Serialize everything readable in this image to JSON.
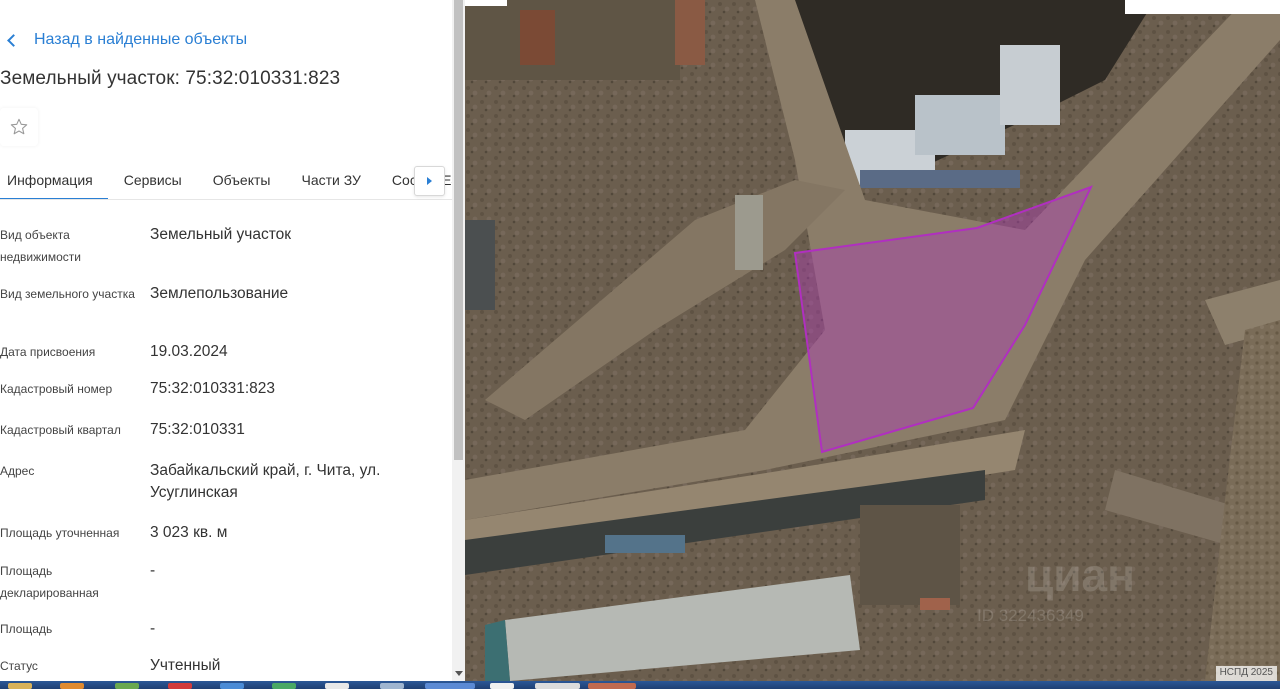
{
  "back_link": "Назад в найденные объекты",
  "page_title": "Земельный участок: 75:32:010331:823",
  "tabs": [
    {
      "label": "Информация",
      "active": true
    },
    {
      "label": "Сервисы",
      "active": false
    },
    {
      "label": "Объекты",
      "active": false
    },
    {
      "label": "Части ЗУ",
      "active": false
    },
    {
      "label": "Состав ЕЗ",
      "active": false
    }
  ],
  "fields": [
    {
      "label": "Вид объекта недвижимости",
      "value": "Земельный участок"
    },
    {
      "label": "Вид земельного участка",
      "value": "Землепользование"
    },
    {
      "label": "Дата присвоения",
      "value": "19.03.2024"
    },
    {
      "label": "Кадастровый номер",
      "value": "75:32:010331:823"
    },
    {
      "label": "Кадастровый квартал",
      "value": "75:32:010331"
    },
    {
      "label": "Адрес",
      "value": "Забайкальский край, г. Чита, ул. Усуглинская"
    },
    {
      "label": "Площадь уточненная",
      "value": "3 023 кв. м"
    },
    {
      "label": "Площадь декларированная",
      "value": "-"
    },
    {
      "label": "Площадь",
      "value": "-"
    },
    {
      "label": "Статус",
      "value": "Учтенный"
    }
  ],
  "map": {
    "badge": "НСПД 2025",
    "watermark": "циан",
    "watermark_id": "ID 322436349",
    "parcel_color": "#b13bb8"
  },
  "colors": {
    "accent": "#2a7fd4"
  }
}
